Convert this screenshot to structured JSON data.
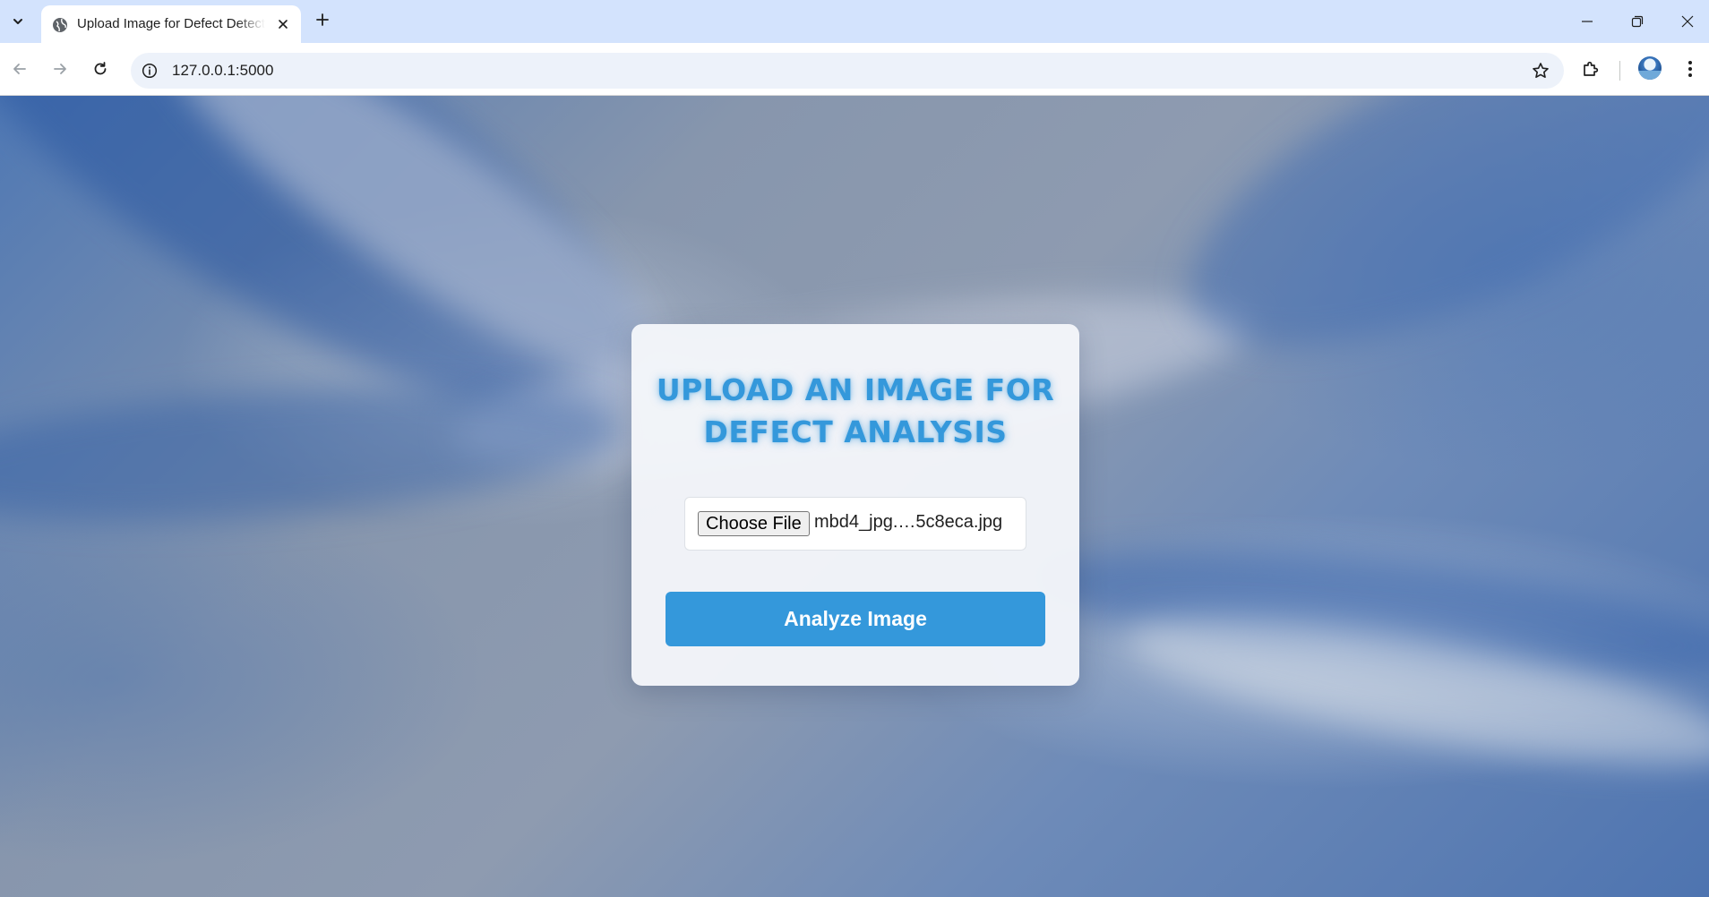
{
  "browser": {
    "tab": {
      "title": "Upload Image for Defect Detection",
      "favicon": "globe-icon"
    },
    "new_tab_icon": "plus-icon",
    "address_bar": {
      "url": "127.0.0.1:5000",
      "site_info_icon": "info-icon",
      "bookmark_icon": "star-icon"
    },
    "window_controls": [
      "minimize-icon",
      "restore-icon",
      "close-icon"
    ]
  },
  "page": {
    "title": "UPLOAD AN IMAGE FOR DEFECT ANALYSIS",
    "file_input": {
      "button_label": "Choose File",
      "selected_file": "mbd4_jpg.…5c8eca.jpg"
    },
    "analyze_button_label": "Analyze Image"
  },
  "colors": {
    "accent": "#3498db",
    "tabstrip": "#d3e3fd",
    "omnibox": "#edf2fa"
  }
}
